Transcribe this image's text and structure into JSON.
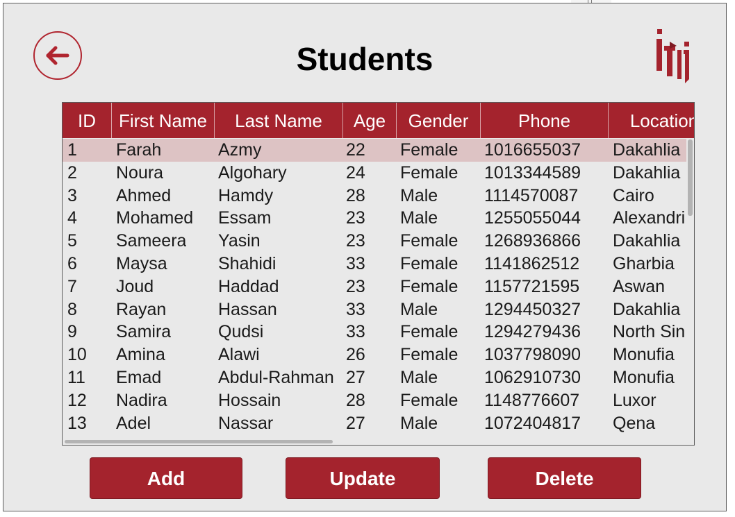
{
  "page": {
    "title": "Students"
  },
  "colors": {
    "accent": "#a4232d",
    "selected_row": "#ddc3c4",
    "background": "#e9e9e9"
  },
  "icons": {
    "back": "arrow-left-icon",
    "logo": "iti-logo"
  },
  "logo_text": "iti",
  "table": {
    "columns": [
      "ID",
      "First Name",
      "Last Name",
      "Age",
      "Gender",
      "Phone",
      "Location"
    ],
    "rows": [
      [
        "1",
        "Farah",
        "Azmy",
        "22",
        "Female",
        "1016655037",
        "Dakahlia"
      ],
      [
        "2",
        "Noura",
        "Algohary",
        "24",
        "Female",
        "1013344589",
        "Dakahlia"
      ],
      [
        "3",
        "Ahmed",
        "Hamdy",
        "28",
        "Male",
        "1114570087",
        "Cairo"
      ],
      [
        "4",
        "Mohamed",
        "Essam",
        "23",
        "Male",
        "1255055044",
        "Alexandri"
      ],
      [
        "5",
        "Sameera",
        "Yasin",
        "23",
        "Female",
        "1268936866",
        "Dakahlia"
      ],
      [
        "6",
        "Maysa",
        "Shahidi",
        "33",
        "Female",
        "1141862512",
        "Gharbia"
      ],
      [
        "7",
        "Joud",
        "Haddad",
        "23",
        "Female",
        "1157721595",
        "Aswan"
      ],
      [
        "8",
        "Rayan",
        "Hassan",
        "33",
        "Male",
        "1294450327",
        "Dakahlia"
      ],
      [
        "9",
        "Samira",
        "Qudsi",
        "33",
        "Female",
        "1294279436",
        "North Sin"
      ],
      [
        "10",
        "Amina",
        "Alawi",
        "26",
        "Female",
        "1037798090",
        "Monufia"
      ],
      [
        "11",
        "Emad",
        "Abdul-Rahman",
        "27",
        "Male",
        "1062910730",
        "Monufia"
      ],
      [
        "12",
        "Nadira",
        "Hossain",
        "28",
        "Female",
        "1148776607",
        "Luxor"
      ],
      [
        "13",
        "Adel",
        "Nassar",
        "27",
        "Male",
        "1072404817",
        "Qena"
      ]
    ],
    "selected_row": 0
  },
  "buttons": {
    "add": "Add",
    "update": "Update",
    "delete": "Delete"
  }
}
